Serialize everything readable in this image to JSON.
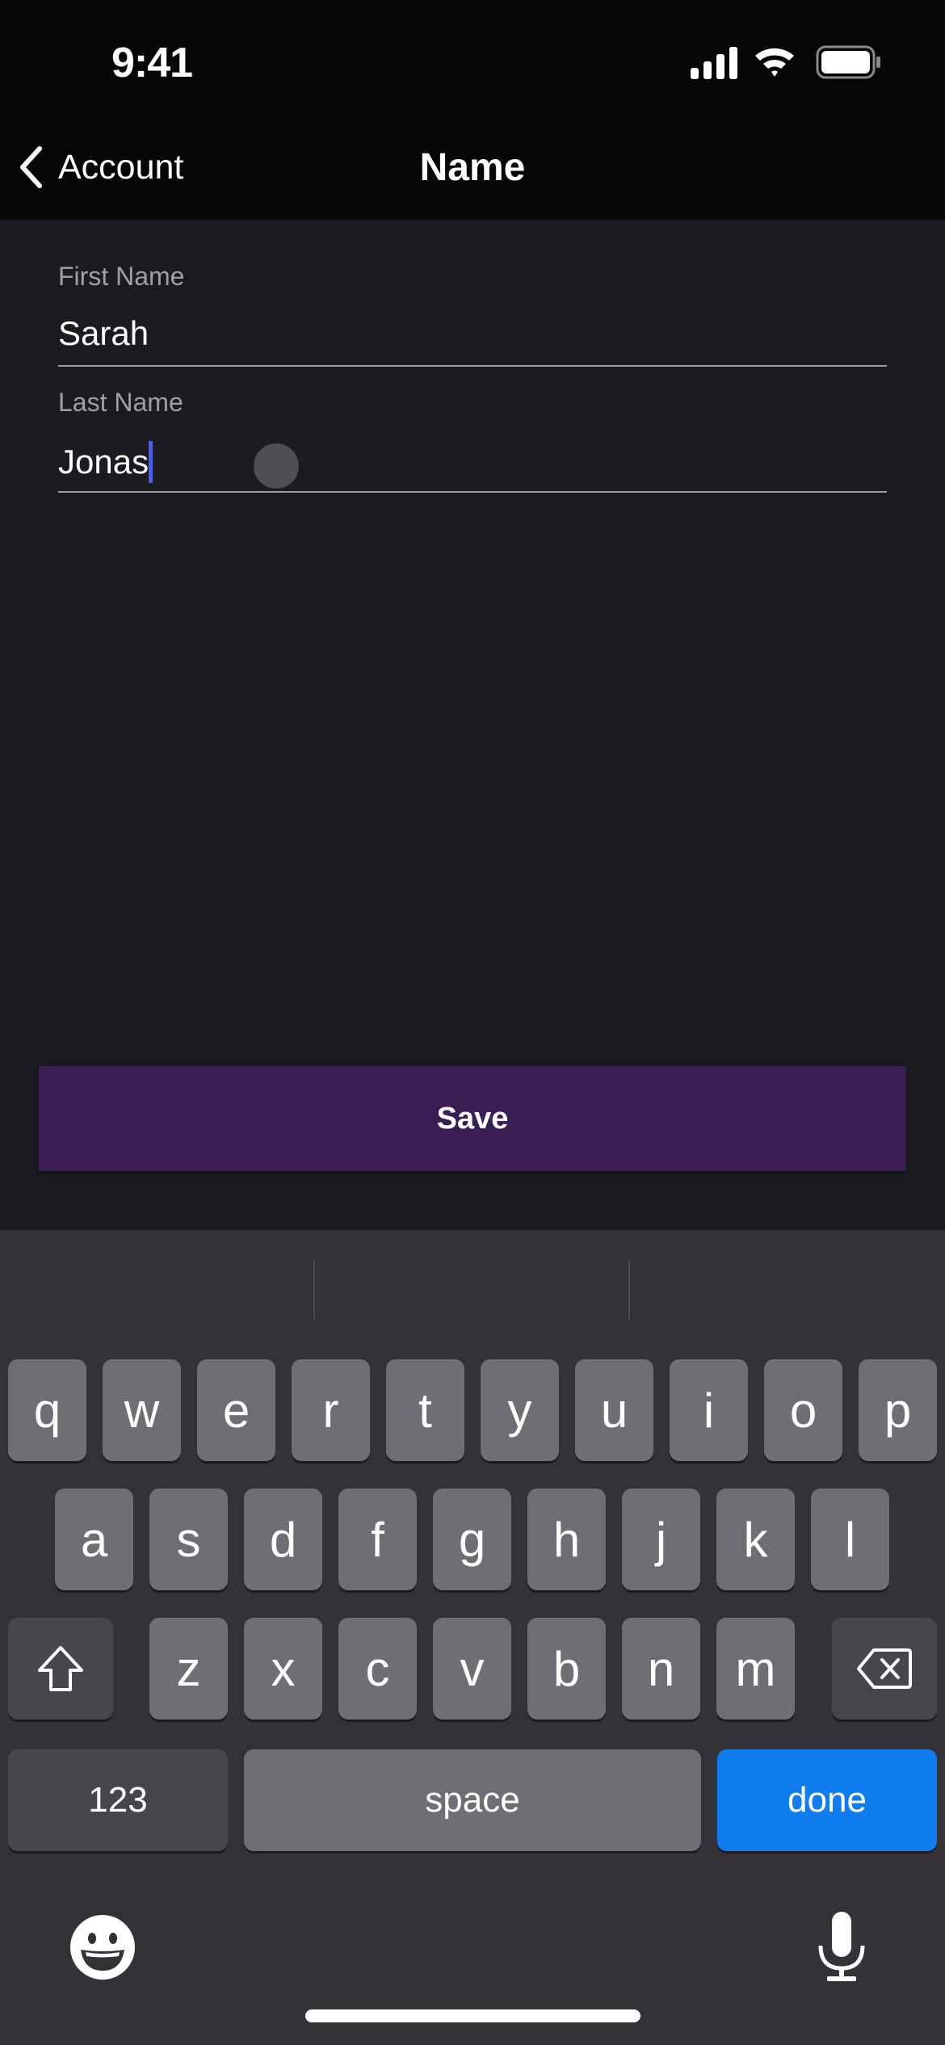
{
  "status_bar": {
    "time": "9:41",
    "icons": [
      "cellular-signal-icon",
      "wifi-icon",
      "battery-icon"
    ]
  },
  "nav": {
    "back_label": "Account",
    "back_icon": "chevron-left-icon",
    "title": "Name"
  },
  "form": {
    "first_name": {
      "label": "First Name",
      "value": "Sarah"
    },
    "last_name": {
      "label": "Last Name",
      "value": "Jonas"
    }
  },
  "save_button": {
    "label": "Save",
    "color": "#3a1d52"
  },
  "keyboard": {
    "rows": [
      [
        "q",
        "w",
        "e",
        "r",
        "t",
        "y",
        "u",
        "i",
        "o",
        "p"
      ],
      [
        "a",
        "s",
        "d",
        "f",
        "g",
        "h",
        "j",
        "k",
        "l"
      ],
      [
        "z",
        "x",
        "c",
        "v",
        "b",
        "n",
        "m"
      ]
    ],
    "shift_icon": "shift-icon",
    "delete_icon": "delete-backspace-icon",
    "numbers_label": "123",
    "space_label": "space",
    "done_label": "done",
    "done_color": "#0f7cf0",
    "emoji_icon": "emoji-icon",
    "mic_icon": "microphone-icon"
  }
}
